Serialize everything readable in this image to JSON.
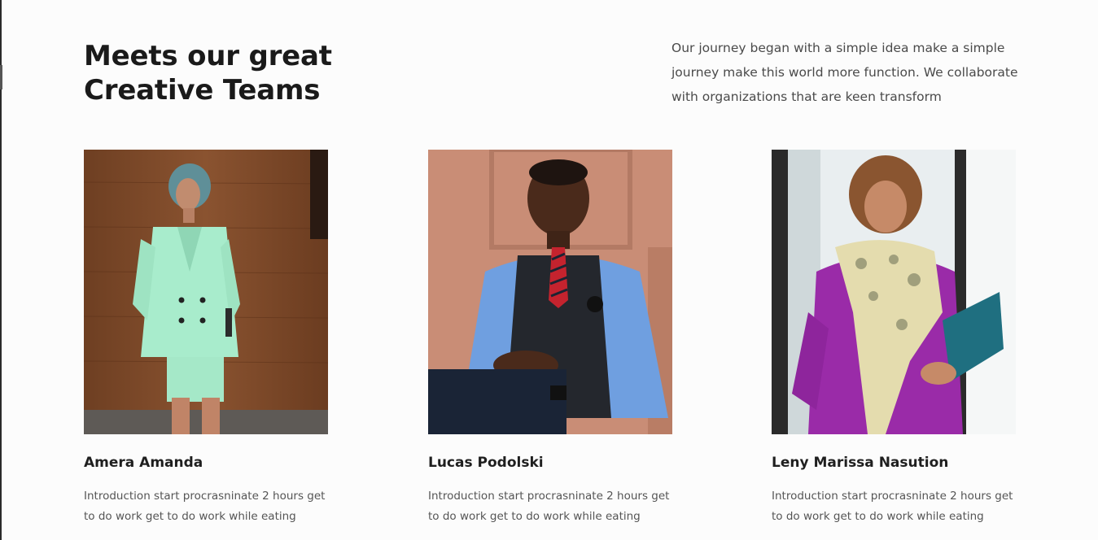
{
  "header": {
    "title_line1": "Meets our great",
    "title_line2": "Creative Teams",
    "intro": "Our journey began with a simple idea make a simple journey make this world more function. We collaborate with organizations that are keen transform"
  },
  "team": [
    {
      "name": "Amera Amanda",
      "bio": "Introduction start procrasninate 2 hours get to do work get to do work while eating",
      "photo": "portrait-woman-mint-suit"
    },
    {
      "name": "Lucas Podolski",
      "bio": "Introduction start procrasninate 2 hours get to do work get to do work while eating",
      "photo": "portrait-man-vest-tie"
    },
    {
      "name": "Leny Marissa Nasution",
      "bio": "Introduction start procrasninate 2 hours get to do work get to do work while eating",
      "photo": "portrait-woman-purple-dress"
    }
  ],
  "colors": {
    "background": "#fcfcfc",
    "heading": "#1a1a1a",
    "body_text": "#4a4a4a"
  }
}
